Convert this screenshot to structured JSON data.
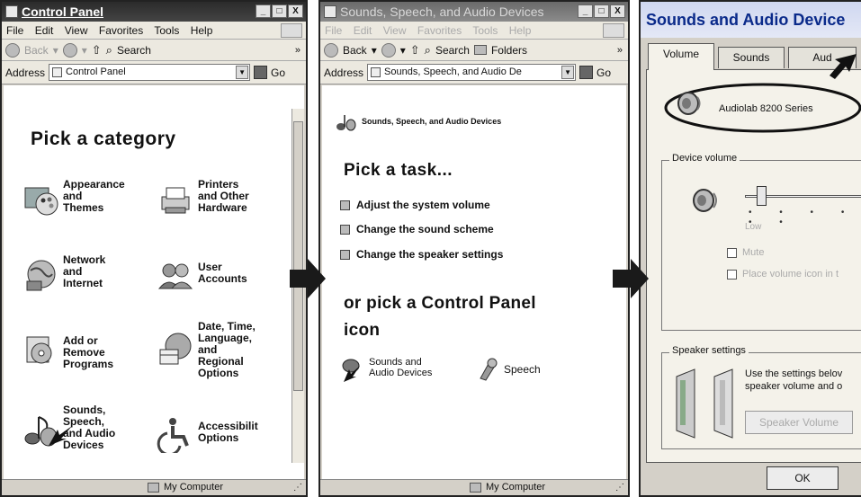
{
  "panel1": {
    "title": "Control Panel",
    "window_buttons": [
      "_",
      "□",
      "X"
    ],
    "menu": [
      "File",
      "Edit",
      "View",
      "Favorites",
      "Tools",
      "Help"
    ],
    "toolbar": {
      "back": "Back",
      "search": "Search",
      "more": "»"
    },
    "address": {
      "label": "Address",
      "value": "Control Panel",
      "go": "Go"
    },
    "heading": "Pick a category",
    "categories": [
      {
        "label": "Appearance\nand\nThemes"
      },
      {
        "label": "Printers\nand Other\nHardware"
      },
      {
        "label": "Network\nand\nInternet"
      },
      {
        "label": "User\nAccounts"
      },
      {
        "label": "Add or\nRemove\nPrograms"
      },
      {
        "label": "Date, Time,\nLanguage,\nand\nRegional\nOptions"
      },
      {
        "label": "Sounds,\nSpeech,\nand Audio\nDevices"
      },
      {
        "label": "Accessibilit\nOptions"
      }
    ],
    "status": "My Computer"
  },
  "panel2": {
    "title": "Sounds, Speech, and Audio Devices",
    "window_buttons": [
      "_",
      "□",
      "X"
    ],
    "menu": [
      "File",
      "Edit",
      "View",
      "Favorites",
      "Tools",
      "Help"
    ],
    "toolbar": {
      "back": "Back",
      "search": "Search",
      "folders": "Folders",
      "more": "»"
    },
    "address": {
      "label": "Address",
      "value": "Sounds, Speech, and Audio De",
      "go": "Go"
    },
    "breadcrumb_title": "Sounds, Speech, and Audio Devices",
    "heading": "Pick a task...",
    "tasks": [
      "Adjust the system volume",
      "Change the sound scheme",
      "Change the speaker settings"
    ],
    "or_heading": "or pick a Control Panel\nicon",
    "icons": [
      {
        "label": "Sounds and\nAudio Devices"
      },
      {
        "label": "Speech"
      }
    ],
    "status": "My Computer"
  },
  "panel3": {
    "title": "Sounds and Audio Device",
    "tabs": [
      "Volume",
      "Sounds",
      "Aud"
    ],
    "device_name": "Audiolab 8200 Series",
    "device_volume": {
      "label": "Device volume",
      "low_label": "Low",
      "level": 0.1,
      "mute_label": "Mute",
      "tray_label": "Place volume icon in t"
    },
    "speaker_settings": {
      "label": "Speaker settings",
      "description": "Use the settings belov\nspeaker volume and o",
      "button": "Speaker Volume"
    },
    "ok": "OK"
  },
  "colors": {
    "highlight_ring": "#111111",
    "arrow": "#1a1a1a",
    "xp_title_blue": "#0a2a8a"
  }
}
